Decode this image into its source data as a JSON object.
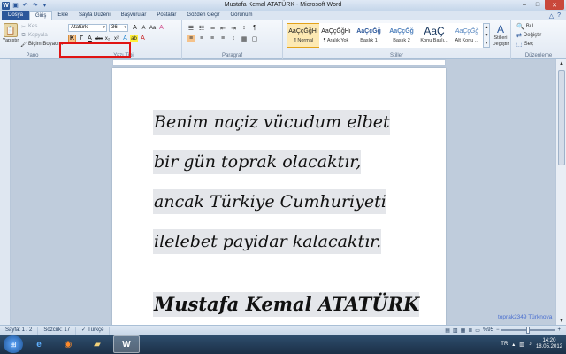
{
  "window": {
    "title": "Mustafa Kemal ATATÜRK - Microsoft Word",
    "controls": {
      "minimize": "–",
      "maximize": "□",
      "close": "✕"
    }
  },
  "qat": [
    {
      "icon": "word-icon",
      "glyph": "W"
    },
    {
      "icon": "save-icon",
      "glyph": "▣"
    },
    {
      "icon": "undo-icon",
      "glyph": "↶"
    },
    {
      "icon": "redo-icon",
      "glyph": "↷"
    },
    {
      "icon": "customize-icon",
      "glyph": "▾"
    }
  ],
  "tabs": [
    "Dosya",
    "Giriş",
    "Ekle",
    "Sayfa Düzeni",
    "Başvurular",
    "Postalar",
    "Gözden Geçir",
    "Görünüm"
  ],
  "tab_active": "Giriş",
  "help": {
    "collapse": "△",
    "help": "?"
  },
  "clipboard": {
    "paste": "Yapıştır",
    "cut": "Kes",
    "copy": "Kopyala",
    "format_painter": "Biçim Boyacısı",
    "group_label": "Pano"
  },
  "font": {
    "name": "Atatürk",
    "size": "36",
    "group_label": "Yazı Tipi",
    "row1": [
      "A",
      "A",
      "Aa",
      "A"
    ],
    "row2": [
      "K",
      "T",
      "A",
      "abc",
      "x₂",
      "x²",
      "A",
      "ab",
      "A"
    ]
  },
  "paragraph": {
    "group_label": "Paragraf",
    "row1": [
      "☰",
      "☷",
      "≔",
      "⇤",
      "⇥",
      "↕",
      "¶"
    ],
    "row2": [
      "≡",
      "≡",
      "≡",
      "≡",
      "↕",
      "▦",
      "▢"
    ]
  },
  "styles": {
    "group_label": "Stiller",
    "items": [
      {
        "sample": "AaÇçĞğHı",
        "name": "¶ Normal",
        "selected": true
      },
      {
        "sample": "AaÇçĞğHı",
        "name": "¶ Aralık Yok",
        "selected": false
      },
      {
        "sample": "AaÇçĞğ",
        "name": "Başlık 1",
        "selected": false
      },
      {
        "sample": "AaÇçĞğ",
        "name": "Başlık 2",
        "selected": false
      },
      {
        "sample": "AaÇ",
        "name": "Konu Başlı...",
        "selected": false
      },
      {
        "sample": "AaÇçĞğ",
        "name": "Alt Konu ...",
        "selected": false
      }
    ],
    "change": "Stilleri Değiştir"
  },
  "editing": {
    "group_label": "Düzenleme",
    "find": "Bul",
    "replace": "Değiştir",
    "select": "Seç"
  },
  "document": {
    "lines": [
      "Benim naçiz vücudum elbet",
      "bir gün toprak olacaktır,",
      "ancak Türkiye Cumhuriyeti",
      "ilelebet payidar kalacaktır."
    ],
    "signature": "Mustafa Kemal ATATÜRK"
  },
  "watermark": "toprak2349 Türknova",
  "status": {
    "page": "Sayfa: 1 / 2",
    "words": "Sözcük: 17",
    "language": "Türkçe",
    "zoom": "%95"
  },
  "taskbar": {
    "language": "TR",
    "time": "14:20",
    "date": "18.05.2012",
    "apps": [
      "ie-icon",
      "firefox-icon",
      "folder-icon",
      "word-icon"
    ]
  },
  "colors": {
    "word_blue": "#2b579a",
    "highlight_red": "#e01414",
    "selected_style": "#fde9b3"
  }
}
